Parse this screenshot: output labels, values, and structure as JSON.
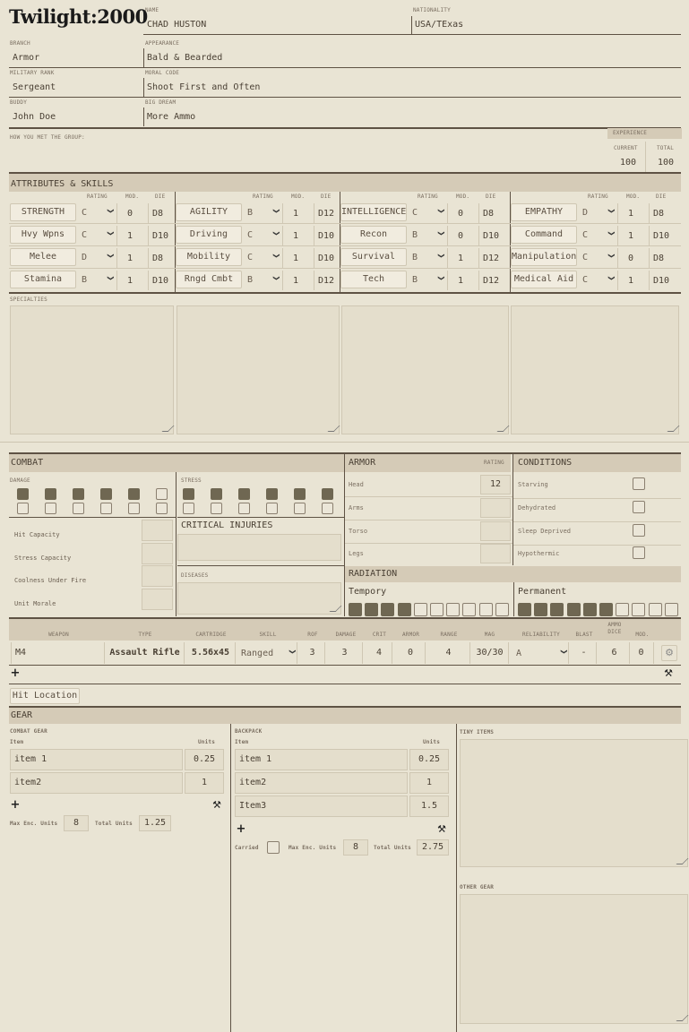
{
  "logo": "Twilight:2000",
  "identity": {
    "name_label": "NAME",
    "name": "CHAD HUSTON",
    "nationality_label": "NATIONALITY",
    "nationality": "USA/TExas",
    "branch_label": "BRANCH",
    "branch": "Armor",
    "appearance_label": "APPEARANCE",
    "appearance": "Bald & Bearded",
    "rank_label": "MILITARY RANK",
    "rank": "Sergeant",
    "moral_label": "MORAL CODE",
    "moral": "Shoot First and Often",
    "buddy_label": "BUDDY",
    "buddy": "John Doe",
    "dream_label": "BIG DREAM",
    "dream": "More Ammo",
    "met_label": "HOW YOU MET THE GROUP:"
  },
  "experience": {
    "label": "EXPERIENCE",
    "current_label": "CURRENT",
    "total_label": "TOTAL",
    "current": "100",
    "total": "100"
  },
  "attributes": {
    "title": "ATTRIBUTES & SKILLS",
    "col_rating": "RATING",
    "col_mod": "MOD.",
    "col_die": "DIE",
    "columns": [
      {
        "rows": [
          {
            "name": "STRENGTH",
            "rating": "C",
            "mod": "0",
            "die": "D8"
          },
          {
            "name": "Hvy Wpns",
            "rating": "C",
            "mod": "1",
            "die": "D10"
          },
          {
            "name": "Melee",
            "rating": "D",
            "mod": "1",
            "die": "D8"
          },
          {
            "name": "Stamina",
            "rating": "B",
            "mod": "1",
            "die": "D10"
          }
        ]
      },
      {
        "rows": [
          {
            "name": "AGILITY",
            "rating": "B",
            "mod": "1",
            "die": "D12"
          },
          {
            "name": "Driving",
            "rating": "C",
            "mod": "1",
            "die": "D10"
          },
          {
            "name": "Mobility",
            "rating": "C",
            "mod": "1",
            "die": "D10"
          },
          {
            "name": "Rngd Cmbt",
            "rating": "B",
            "mod": "1",
            "die": "D12"
          }
        ]
      },
      {
        "rows": [
          {
            "name": "INTELLIGENCE",
            "rating": "C",
            "mod": "0",
            "die": "D8"
          },
          {
            "name": "Recon",
            "rating": "B",
            "mod": "0",
            "die": "D10"
          },
          {
            "name": "Survival",
            "rating": "B",
            "mod": "1",
            "die": "D12"
          },
          {
            "name": "Tech",
            "rating": "B",
            "mod": "1",
            "die": "D12"
          }
        ]
      },
      {
        "rows": [
          {
            "name": "EMPATHY",
            "rating": "D",
            "mod": "1",
            "die": "D8"
          },
          {
            "name": "Command",
            "rating": "C",
            "mod": "1",
            "die": "D10"
          },
          {
            "name": "Manipulation",
            "rating": "C",
            "mod": "0",
            "die": "D8"
          },
          {
            "name": "Medical Aid",
            "rating": "C",
            "mod": "1",
            "die": "D10"
          }
        ]
      }
    ],
    "specialties_label": "SPECIALTIES"
  },
  "combat": {
    "title": "COMBAT",
    "damage_label": "DAMAGE",
    "stress_label": "STRESS",
    "damage_boxes": [
      1,
      1,
      1,
      1,
      1,
      0,
      0,
      0,
      0,
      0,
      0,
      0
    ],
    "stress_boxes": [
      1,
      1,
      1,
      1,
      1,
      1,
      0,
      0,
      0,
      0,
      0,
      0
    ],
    "stats": [
      "Hit Capacity",
      "Stress Capacity",
      "Coolness Under Fire",
      "Unit Morale"
    ],
    "critical_label": "CRITICAL INJURIES",
    "diseases_label": "DISEASES"
  },
  "armor": {
    "title": "ARMOR",
    "rating_label": "RATING",
    "rows": [
      {
        "loc": "Head",
        "rating": "12"
      },
      {
        "loc": "Arms",
        "rating": ""
      },
      {
        "loc": "Torso",
        "rating": ""
      },
      {
        "loc": "Legs",
        "rating": ""
      }
    ]
  },
  "conditions": {
    "title": "CONDITIONS",
    "items": [
      "Starving",
      "Dehydrated",
      "Sleep Deprived",
      "Hypothermic"
    ]
  },
  "radiation": {
    "title": "RADIATION",
    "temp_label": "Tempory",
    "perm_label": "Permanent",
    "temp_boxes": [
      1,
      1,
      1,
      1,
      0,
      0,
      0,
      0,
      0,
      0
    ],
    "perm_boxes": [
      1,
      1,
      1,
      1,
      1,
      1,
      0,
      0,
      0,
      0
    ]
  },
  "weapons": {
    "headers": [
      "WEAPON",
      "TYPE",
      "CARTRIDGE",
      "SKILL",
      "ROF",
      "DAMAGE",
      "CRIT",
      "ARMOR",
      "RANGE",
      "MAG",
      "RELIABILITY",
      "BLAST",
      "AMMO DICE",
      "MOD."
    ],
    "rows": [
      {
        "weapon": "M4",
        "type": "Assault Rifle",
        "cartridge": "5.56x45",
        "skill": "Ranged",
        "rof": "3",
        "damage": "3",
        "crit": "4",
        "armor": "0",
        "range": "4",
        "mag": "30/30",
        "reliability": "A",
        "blast": "-",
        "ammo": "6",
        "mod": "0"
      }
    ]
  },
  "hit_location_label": "Hit Location",
  "gear": {
    "title": "GEAR",
    "combat_gear": {
      "label": "COMBAT GEAR",
      "item_col": "Item",
      "units_col": "Units",
      "items": [
        {
          "name": "item 1",
          "units": "0.25"
        },
        {
          "name": "item2",
          "units": "1"
        }
      ],
      "max_label": "Max Enc. Units",
      "max": "8",
      "total_label": "Total Units",
      "total": "1.25"
    },
    "backpack": {
      "label": "BACKPACK",
      "item_col": "Item",
      "units_col": "Units",
      "items": [
        {
          "name": "item 1",
          "units": "0.25"
        },
        {
          "name": "item2",
          "units": "1"
        },
        {
          "name": "Item3",
          "units": "1.5"
        }
      ],
      "carried_label": "Carried",
      "max_label": "Max Enc. Units",
      "max": "8",
      "total_label": "Total Units",
      "total": "2.75"
    },
    "tiny_label": "TINY ITEMS",
    "other_label": "OTHER GEAR"
  }
}
